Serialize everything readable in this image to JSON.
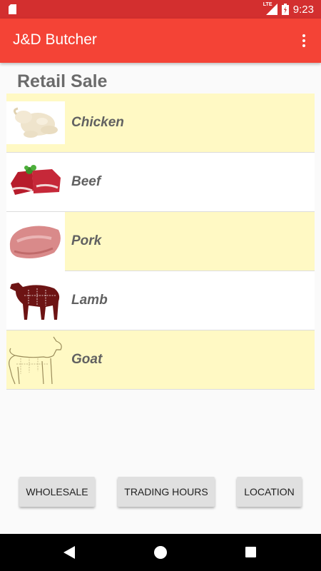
{
  "status_bar": {
    "network_label": "LTE",
    "time": "9:23",
    "icons": [
      "sim-card-icon",
      "lte-signal-icon",
      "battery-charging-icon"
    ]
  },
  "app_bar": {
    "title": "J&D Butcher",
    "menu_icon": "more-vert-icon",
    "color": "#f44336"
  },
  "section": {
    "title": "Retail Sale"
  },
  "items": [
    {
      "label": "Chicken",
      "image": "chicken-image"
    },
    {
      "label": "Beef",
      "image": "beef-image"
    },
    {
      "label": "Pork",
      "image": "pork-image"
    },
    {
      "label": "Lamb",
      "image": "lamb-image"
    },
    {
      "label": "Goat",
      "image": "goat-image"
    }
  ],
  "buttons": {
    "wholesale": "WHOLESALE",
    "trading_hours": "TRADING HOURS",
    "location": "LOCATION"
  },
  "nav_bar": {
    "icons": [
      "back-icon",
      "home-icon",
      "recents-icon"
    ]
  },
  "colors": {
    "status_bar": "#d32f2f",
    "row_highlight": "#fff9c4",
    "label_text": "#616161"
  }
}
